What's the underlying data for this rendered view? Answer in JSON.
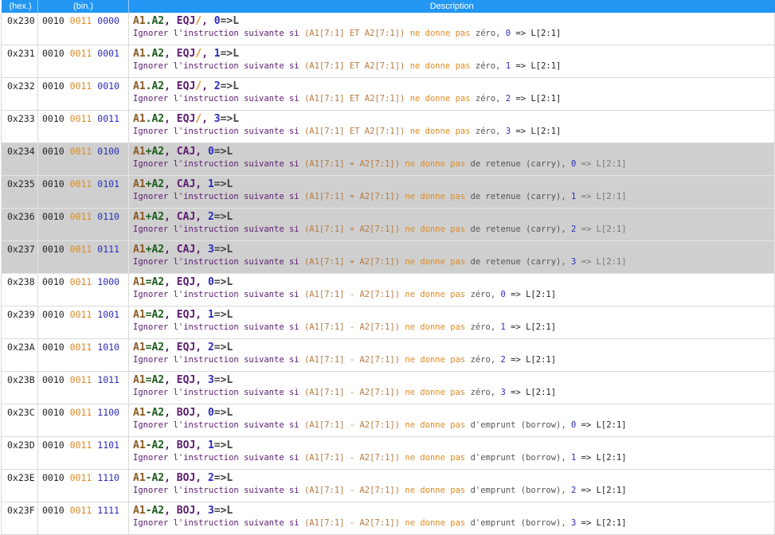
{
  "header": {
    "hex": "(hex.)",
    "bin": "(bin.)",
    "desc": "Description"
  },
  "rows": [
    {
      "hex": "0x230",
      "b1": "0010",
      "b2": "0011",
      "b3": "0000",
      "m_op1": "A1",
      "m_sep": ".",
      "m_op2": "A2",
      "m_comma1": ", ",
      "m_cond": "EQJ",
      "m_slash": "/",
      "m_comma2": ", ",
      "m_num": "0",
      "m_arrow": "=>L",
      "d_pre": "Ignorer l'instruction suivante si ",
      "d_expr": "(A1[7:1] ET A2[7:1])",
      "d_mid": " ne donne pas ",
      "d_tail": "zéro, ",
      "d_num": "0",
      "d_end": " => L[2:1]"
    },
    {
      "hex": "0x231",
      "b1": "0010",
      "b2": "0011",
      "b3": "0001",
      "m_op1": "A1",
      "m_sep": ".",
      "m_op2": "A2",
      "m_comma1": ", ",
      "m_cond": "EQJ",
      "m_slash": "/",
      "m_comma2": ", ",
      "m_num": "1",
      "m_arrow": "=>L",
      "d_pre": "Ignorer l'instruction suivante si ",
      "d_expr": "(A1[7:1] ET A2[7:1])",
      "d_mid": " ne donne pas ",
      "d_tail": "zéro, ",
      "d_num": "1",
      "d_end": " => L[2:1]"
    },
    {
      "hex": "0x232",
      "b1": "0010",
      "b2": "0011",
      "b3": "0010",
      "m_op1": "A1",
      "m_sep": ".",
      "m_op2": "A2",
      "m_comma1": ", ",
      "m_cond": "EQJ",
      "m_slash": "/",
      "m_comma2": ", ",
      "m_num": "2",
      "m_arrow": "=>L",
      "d_pre": "Ignorer l'instruction suivante si ",
      "d_expr": "(A1[7:1] ET A2[7:1])",
      "d_mid": " ne donne pas ",
      "d_tail": "zéro, ",
      "d_num": "2",
      "d_end": " => L[2:1]"
    },
    {
      "hex": "0x233",
      "b1": "0010",
      "b2": "0011",
      "b3": "0011",
      "m_op1": "A1",
      "m_sep": ".",
      "m_op2": "A2",
      "m_comma1": ", ",
      "m_cond": "EQJ",
      "m_slash": "/",
      "m_comma2": ", ",
      "m_num": "3",
      "m_arrow": "=>L",
      "d_pre": "Ignorer l'instruction suivante si ",
      "d_expr": "(A1[7:1] ET A2[7:1])",
      "d_mid": " ne donne pas ",
      "d_tail": "zéro, ",
      "d_num": "3",
      "d_end": " => L[2:1]"
    },
    {
      "hex": "0x234",
      "shaded": true,
      "b1": "0010",
      "b2": "0011",
      "b3": "0100",
      "m_op1": "A1",
      "m_sep": "+",
      "m_op2": "A2",
      "m_comma1": ", ",
      "m_cond": "CAJ",
      "m_slash": "",
      "m_comma2": ", ",
      "m_num": "0",
      "m_arrow": "=>L",
      "d_pre": "Ignorer l'instruction suivante si ",
      "d_expr": "(A1[7:1] + A2[7:1])",
      "d_mid": " ne donne pas ",
      "d_tail": "de retenue (carry), ",
      "d_num": "0",
      "d_end": " => L[2:1]"
    },
    {
      "hex": "0x235",
      "shaded": true,
      "b1": "0010",
      "b2": "0011",
      "b3": "0101",
      "m_op1": "A1",
      "m_sep": "+",
      "m_op2": "A2",
      "m_comma1": ", ",
      "m_cond": "CAJ",
      "m_slash": "",
      "m_comma2": ", ",
      "m_num": "1",
      "m_arrow": "=>L",
      "d_pre": "Ignorer l'instruction suivante si ",
      "d_expr": "(A1[7:1] + A2[7:1])",
      "d_mid": " ne donne pas ",
      "d_tail": "de retenue (carry), ",
      "d_num": "1",
      "d_end": " => L[2:1]"
    },
    {
      "hex": "0x236",
      "shaded": true,
      "b1": "0010",
      "b2": "0011",
      "b3": "0110",
      "m_op1": "A1",
      "m_sep": "+",
      "m_op2": "A2",
      "m_comma1": ", ",
      "m_cond": "CAJ",
      "m_slash": "",
      "m_comma2": ", ",
      "m_num": "2",
      "m_arrow": "=>L",
      "d_pre": "Ignorer l'instruction suivante si ",
      "d_expr": "(A1[7:1] + A2[7:1])",
      "d_mid": " ne donne pas ",
      "d_tail": "de retenue (carry), ",
      "d_num": "2",
      "d_end": " => L[2:1]"
    },
    {
      "hex": "0x237",
      "shaded": true,
      "b1": "0010",
      "b2": "0011",
      "b3": "0111",
      "m_op1": "A1",
      "m_sep": "+",
      "m_op2": "A2",
      "m_comma1": ", ",
      "m_cond": "CAJ",
      "m_slash": "",
      "m_comma2": ", ",
      "m_num": "3",
      "m_arrow": "=>L",
      "d_pre": "Ignorer l'instruction suivante si ",
      "d_expr": "(A1[7:1] + A2[7:1])",
      "d_mid": " ne donne pas ",
      "d_tail": "de retenue (carry), ",
      "d_num": "3",
      "d_end": " => L[2:1]"
    },
    {
      "hex": "0x238",
      "b1": "0010",
      "b2": "0011",
      "b3": "1000",
      "m_op1": "A1",
      "m_sep": "=",
      "m_op2": "A2",
      "m_comma1": ", ",
      "m_cond": "EQJ",
      "m_slash": "",
      "m_comma2": ", ",
      "m_num": "0",
      "m_arrow": "=>L",
      "d_pre": "Ignorer l'instruction suivante si ",
      "d_expr": "(A1[7:1] - A2[7:1])",
      "d_mid": " ne donne pas ",
      "d_tail": "zéro, ",
      "d_num": "0",
      "d_end": " => L[2:1]"
    },
    {
      "hex": "0x239",
      "b1": "0010",
      "b2": "0011",
      "b3": "1001",
      "m_op1": "A1",
      "m_sep": "=",
      "m_op2": "A2",
      "m_comma1": ", ",
      "m_cond": "EQJ",
      "m_slash": "",
      "m_comma2": ", ",
      "m_num": "1",
      "m_arrow": "=>L",
      "d_pre": "Ignorer l'instruction suivante si ",
      "d_expr": "(A1[7:1] - A2[7:1])",
      "d_mid": " ne donne pas ",
      "d_tail": "zéro, ",
      "d_num": "1",
      "d_end": " => L[2:1]"
    },
    {
      "hex": "0x23A",
      "b1": "0010",
      "b2": "0011",
      "b3": "1010",
      "m_op1": "A1",
      "m_sep": "=",
      "m_op2": "A2",
      "m_comma1": ", ",
      "m_cond": "EQJ",
      "m_slash": "",
      "m_comma2": ", ",
      "m_num": "2",
      "m_arrow": "=>L",
      "d_pre": "Ignorer l'instruction suivante si ",
      "d_expr": "(A1[7:1] - A2[7:1])",
      "d_mid": " ne donne pas ",
      "d_tail": "zéro, ",
      "d_num": "2",
      "d_end": " => L[2:1]"
    },
    {
      "hex": "0x23B",
      "b1": "0010",
      "b2": "0011",
      "b3": "1011",
      "m_op1": "A1",
      "m_sep": "=",
      "m_op2": "A2",
      "m_comma1": ", ",
      "m_cond": "EQJ",
      "m_slash": "",
      "m_comma2": ", ",
      "m_num": "3",
      "m_arrow": "=>L",
      "d_pre": "Ignorer l'instruction suivante si ",
      "d_expr": "(A1[7:1] - A2[7:1])",
      "d_mid": " ne donne pas ",
      "d_tail": "zéro, ",
      "d_num": "3",
      "d_end": " => L[2:1]"
    },
    {
      "hex": "0x23C",
      "b1": "0010",
      "b2": "0011",
      "b3": "1100",
      "m_op1": "A1",
      "m_sep": "-",
      "m_op2": "A2",
      "m_comma1": ", ",
      "m_cond": "BOJ",
      "m_slash": "",
      "m_comma2": ", ",
      "m_num": "0",
      "m_arrow": "=>L",
      "d_pre": "Ignorer l'instruction suivante si ",
      "d_expr": "(A1[7:1] - A2[7:1])",
      "d_mid": " ne donne pas ",
      "d_tail": "d'emprunt (borrow), ",
      "d_num": "0",
      "d_end": " => L[2:1]"
    },
    {
      "hex": "0x23D",
      "b1": "0010",
      "b2": "0011",
      "b3": "1101",
      "m_op1": "A1",
      "m_sep": "-",
      "m_op2": "A2",
      "m_comma1": ", ",
      "m_cond": "BOJ",
      "m_slash": "",
      "m_comma2": ", ",
      "m_num": "1",
      "m_arrow": "=>L",
      "d_pre": "Ignorer l'instruction suivante si ",
      "d_expr": "(A1[7:1] - A2[7:1])",
      "d_mid": " ne donne pas ",
      "d_tail": "d'emprunt (borrow), ",
      "d_num": "1",
      "d_end": " => L[2:1]"
    },
    {
      "hex": "0x23E",
      "b1": "0010",
      "b2": "0011",
      "b3": "1110",
      "m_op1": "A1",
      "m_sep": "-",
      "m_op2": "A2",
      "m_comma1": ", ",
      "m_cond": "BOJ",
      "m_slash": "",
      "m_comma2": ", ",
      "m_num": "2",
      "m_arrow": "=>L",
      "d_pre": "Ignorer l'instruction suivante si ",
      "d_expr": "(A1[7:1] - A2[7:1])",
      "d_mid": " ne donne pas ",
      "d_tail": "d'emprunt (borrow), ",
      "d_num": "2",
      "d_end": " => L[2:1]"
    },
    {
      "hex": "0x23F",
      "b1": "0010",
      "b2": "0011",
      "b3": "1111",
      "m_op1": "A1",
      "m_sep": "-",
      "m_op2": "A2",
      "m_comma1": ", ",
      "m_cond": "BOJ",
      "m_slash": "",
      "m_comma2": ", ",
      "m_num": "3",
      "m_arrow": "=>L",
      "d_pre": "Ignorer l'instruction suivante si ",
      "d_expr": "(A1[7:1] - A2[7:1])",
      "d_mid": " ne donne pas ",
      "d_tail": "d'emprunt (borrow), ",
      "d_num": "3",
      "d_end": " => L[2:1]"
    }
  ]
}
